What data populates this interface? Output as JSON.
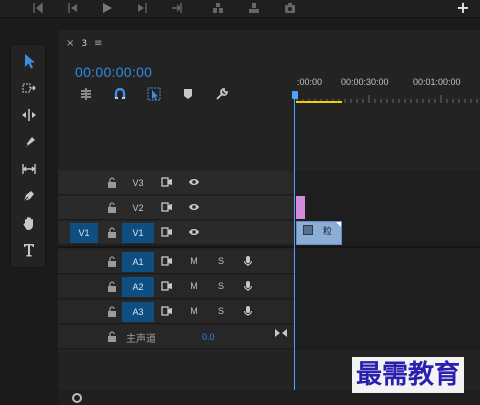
{
  "transport": {
    "buttons": [
      "mark-in-icon",
      "step-back-icon",
      "play-icon",
      "step-forward-icon",
      "go-to-out-icon",
      "insert-icon",
      "overwrite-icon",
      "camera-icon"
    ],
    "add_label": "+"
  },
  "tools": [
    "selection-tool-icon",
    "track-select-tool-icon",
    "ripple-edit-tool-icon",
    "razor-tool-icon",
    "slip-tool-icon",
    "pen-tool-icon",
    "hand-tool-icon",
    "type-tool-icon"
  ],
  "sequence": {
    "tab_close": "×",
    "tab_name": "3",
    "tab_menu": "≡",
    "timecode": "00:00:00:00"
  },
  "ruler": {
    "labels": [
      ":00:00",
      "00:00:30:00",
      "00:01:00:00"
    ]
  },
  "tracks": {
    "video": [
      {
        "name": "V3",
        "source": ""
      },
      {
        "name": "V2",
        "source": ""
      },
      {
        "name": "V1",
        "source": "V1"
      }
    ],
    "audio": [
      {
        "name": "A1",
        "mute": "M",
        "solo": "S"
      },
      {
        "name": "A2",
        "mute": "M",
        "solo": "S"
      },
      {
        "name": "A3",
        "mute": "M",
        "solo": "S"
      }
    ],
    "master": {
      "label": "主声道",
      "value": "0.0"
    }
  },
  "clips": {
    "v1_clip_label": "粒"
  },
  "colors": {
    "accent": "#2e8ce6",
    "track_target": "#0f4e80",
    "clip_video_pink": "#d48ad6",
    "clip_video_blue": "#8caed6",
    "work_area": "#e8d200"
  },
  "watermark": "最需教育"
}
